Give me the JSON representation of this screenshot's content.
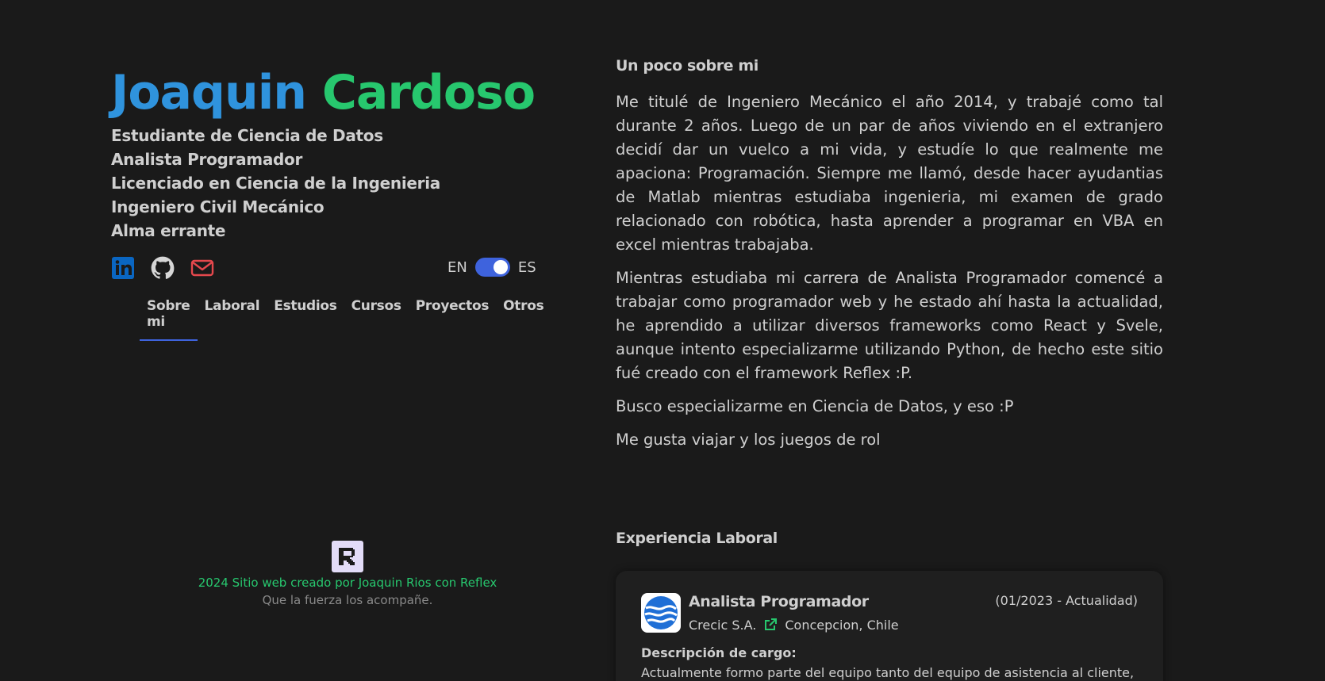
{
  "profile": {
    "first_name": "Joaquin",
    "last_name": "Cardoso",
    "titles": [
      "Estudiante de Ciencia de Datos",
      "Analista Programador",
      "Licenciado en Ciencia de la Ingenieria",
      "Ingeniero Civil Mecánico",
      "Alma errante"
    ]
  },
  "social": {
    "icons": [
      "linkedin-icon",
      "github-icon",
      "mail-icon"
    ],
    "colors": {
      "linkedin": "#0a66c2",
      "github": "#d6d6d6",
      "mail": "#e5484d"
    }
  },
  "lang_toggle": {
    "left": "EN",
    "right": "ES",
    "selected": "ES"
  },
  "tabs": [
    "Sobre mi",
    "Laboral",
    "Estudios",
    "Cursos",
    "Proyectos",
    "Otros"
  ],
  "about": {
    "title": "Un poco sobre mi",
    "paragraphs": [
      "Me titulé de Ingeniero Mecánico el año 2014, y trabajé como tal durante 2 años. Luego de un par de años viviendo en el extranjero decidí dar un vuelco a mi vida, y estudíe lo que realmente me apaciona: Programación. Siempre me llamó, desde hacer ayudantias de Matlab mientras estudiaba ingenieria, mi examen de grado relacionado con robótica, hasta aprender a programar en VBA en excel mientras trabajaba.",
      "Mientras estudiaba mi carrera de Analista Programador comencé a trabajar como programador web y he estado ahí hasta la actualidad, he aprendido a utilizar diversos frameworks como React y Svele, aunque intento especializarme utilizando Python, de hecho este sitio fué creado con el framework Reflex :P.",
      "Busco especializarme en Ciencia de Datos, y eso :P",
      "Me gusta viajar y los juegos de rol"
    ]
  },
  "experience": {
    "title": "Experiencia Laboral",
    "jobs": [
      {
        "role": "Analista Programador",
        "company": "Crecic S.A.",
        "location": "Concepcion, Chile",
        "dates": "(01/2023 - Actualidad)",
        "desc_label": "Descripción de cargo:",
        "desc": "Actualmente formo parte del equipo tanto del equipo de asistencia al cliente,"
      }
    ]
  },
  "footer": {
    "credit": "2024 Sitio web creado por Joaquin Rios con Reflex",
    "quote": "Que la fuerza los acompañe."
  },
  "accent": {
    "blue": "#2f93dd",
    "green": "#27c76e",
    "indigo": "#3e63dd"
  }
}
